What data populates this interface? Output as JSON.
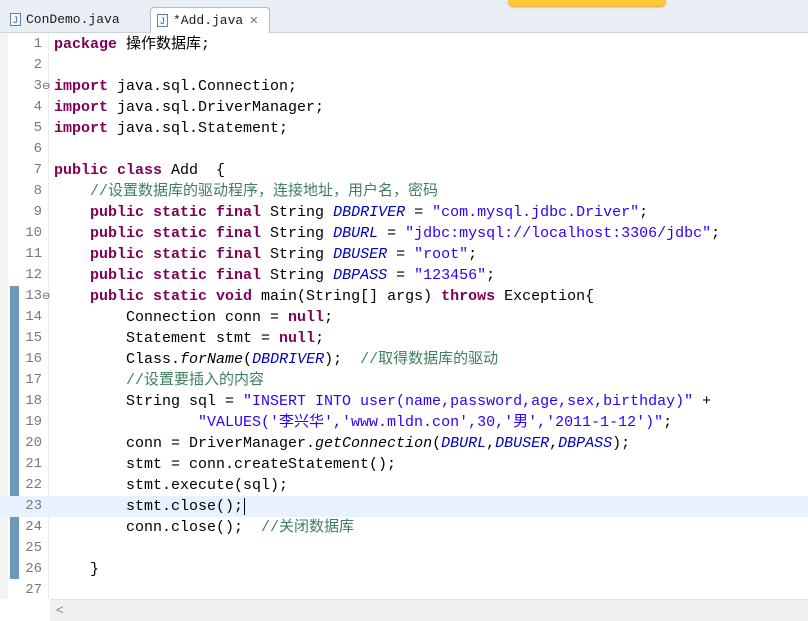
{
  "tabs": [
    {
      "label": "ConDemo.java",
      "icon": "java-file-icon",
      "active": false
    },
    {
      "label": "*Add.java",
      "icon": "java-file-icon",
      "active": true,
      "close": "✕"
    }
  ],
  "editor": {
    "current_line": 23,
    "lines": [
      {
        "n": "1",
        "tokens": [
          [
            "kw",
            "package"
          ],
          [
            "",
            ""
          ],
          [
            "",
            "操作数据库;"
          ]
        ]
      },
      {
        "n": "2",
        "tokens": []
      },
      {
        "n": "3",
        "fold": "⊖",
        "tokens": [
          [
            "kw",
            "import"
          ],
          [
            "",
            "java.sql.Connection;"
          ]
        ]
      },
      {
        "n": "4",
        "tokens": [
          [
            "kw",
            "import"
          ],
          [
            "",
            "java.sql.DriverManager;"
          ]
        ]
      },
      {
        "n": "5",
        "tokens": [
          [
            "kw",
            "import"
          ],
          [
            "",
            "java.sql.Statement;"
          ]
        ]
      },
      {
        "n": "6",
        "tokens": []
      },
      {
        "n": "7",
        "tokens": [
          [
            "kw",
            "public class"
          ],
          [
            "",
            "Add  {"
          ]
        ]
      },
      {
        "n": "8",
        "tokens": [
          [
            "",
            "    "
          ],
          [
            "cmt",
            "//设置数据库的驱动程序，连接地址，用户名，密码"
          ]
        ]
      },
      {
        "n": "9",
        "tokens": [
          [
            "",
            "    "
          ],
          [
            "kw",
            "public static final"
          ],
          [
            "",
            " String "
          ],
          [
            "fld",
            "DBDRIVER"
          ],
          [
            "",
            " = "
          ],
          [
            "str",
            "\"com.mysql.jdbc.Driver\""
          ],
          [
            "",
            ";"
          ]
        ]
      },
      {
        "n": "10",
        "tokens": [
          [
            "",
            "    "
          ],
          [
            "kw",
            "public static final"
          ],
          [
            "",
            " String "
          ],
          [
            "fld",
            "DBURL"
          ],
          [
            "",
            " = "
          ],
          [
            "str",
            "\"jdbc:mysql://localhost:3306/jdbc\""
          ],
          [
            "",
            ";"
          ]
        ]
      },
      {
        "n": "11",
        "tokens": [
          [
            "",
            "    "
          ],
          [
            "kw",
            "public static final"
          ],
          [
            "",
            " String "
          ],
          [
            "fld",
            "DBUSER"
          ],
          [
            "",
            " = "
          ],
          [
            "str",
            "\"root\""
          ],
          [
            "",
            ";"
          ]
        ]
      },
      {
        "n": "12",
        "tokens": [
          [
            "",
            "    "
          ],
          [
            "kw",
            "public static final"
          ],
          [
            "",
            " String "
          ],
          [
            "fld",
            "DBPASS"
          ],
          [
            "",
            " = "
          ],
          [
            "str",
            "\"123456\""
          ],
          [
            "",
            ";"
          ]
        ]
      },
      {
        "n": "13",
        "fold": "⊖",
        "tokens": [
          [
            "",
            "    "
          ],
          [
            "kw",
            "public static void"
          ],
          [
            "",
            " main(String[] args) "
          ],
          [
            "kw",
            "throws"
          ],
          [
            "",
            " Exception{"
          ]
        ]
      },
      {
        "n": "14",
        "tokens": [
          [
            "",
            "        Connection conn = "
          ],
          [
            "kw",
            "null"
          ],
          [
            "",
            ";"
          ]
        ]
      },
      {
        "n": "15",
        "tokens": [
          [
            "",
            "        Statement stmt = "
          ],
          [
            "kw",
            "null"
          ],
          [
            "",
            ";"
          ]
        ]
      },
      {
        "n": "16",
        "tokens": [
          [
            "",
            "        Class."
          ],
          [
            "mth",
            "forName"
          ],
          [
            "",
            "("
          ],
          [
            "fld",
            "DBDRIVER"
          ],
          [
            "",
            ");  "
          ],
          [
            "cmt",
            "//取得数据库的驱动"
          ]
        ]
      },
      {
        "n": "17",
        "tokens": [
          [
            "",
            "        "
          ],
          [
            "cmt",
            "//设置要插入的内容"
          ]
        ]
      },
      {
        "n": "18",
        "tokens": [
          [
            "",
            "        String sql = "
          ],
          [
            "str",
            "\"INSERT INTO user(name,password,age,sex,birthday)\""
          ],
          [
            "",
            " +"
          ]
        ]
      },
      {
        "n": "19",
        "tokens": [
          [
            "",
            "                "
          ],
          [
            "str",
            "\"VALUES('李兴华','www.mldn.con',30,'男','2011-1-12')\""
          ],
          [
            "",
            ";"
          ]
        ]
      },
      {
        "n": "20",
        "tokens": [
          [
            "",
            "        conn = DriverManager."
          ],
          [
            "mth",
            "getConnection"
          ],
          [
            "",
            "("
          ],
          [
            "fld",
            "DBURL"
          ],
          [
            "",
            ","
          ],
          [
            "fld",
            "DBUSER"
          ],
          [
            "",
            ","
          ],
          [
            "fld",
            "DBPASS"
          ],
          [
            "",
            ");"
          ]
        ]
      },
      {
        "n": "21",
        "tokens": [
          [
            "",
            "        stmt = conn.createStatement();"
          ]
        ]
      },
      {
        "n": "22",
        "tokens": [
          [
            "",
            "        stmt.execute(sql);"
          ]
        ]
      },
      {
        "n": "23",
        "tokens": [
          [
            "",
            "        stmt.close();"
          ]
        ],
        "caret": true
      },
      {
        "n": "24",
        "tokens": [
          [
            "",
            "        conn.close();  "
          ],
          [
            "cmt",
            "//关闭数据库"
          ]
        ]
      },
      {
        "n": "25",
        "tokens": []
      },
      {
        "n": "26",
        "tokens": [
          [
            "",
            "    }"
          ]
        ]
      },
      {
        "n": "27",
        "tokens": []
      }
    ]
  },
  "scrollbar": {
    "left_arrow": "<"
  },
  "colors": {
    "keyword": "#7f0055",
    "string": "#2a00ff",
    "comment": "#3f7f5f",
    "field": "#0000c0",
    "current_line": "#e8f2fe"
  }
}
